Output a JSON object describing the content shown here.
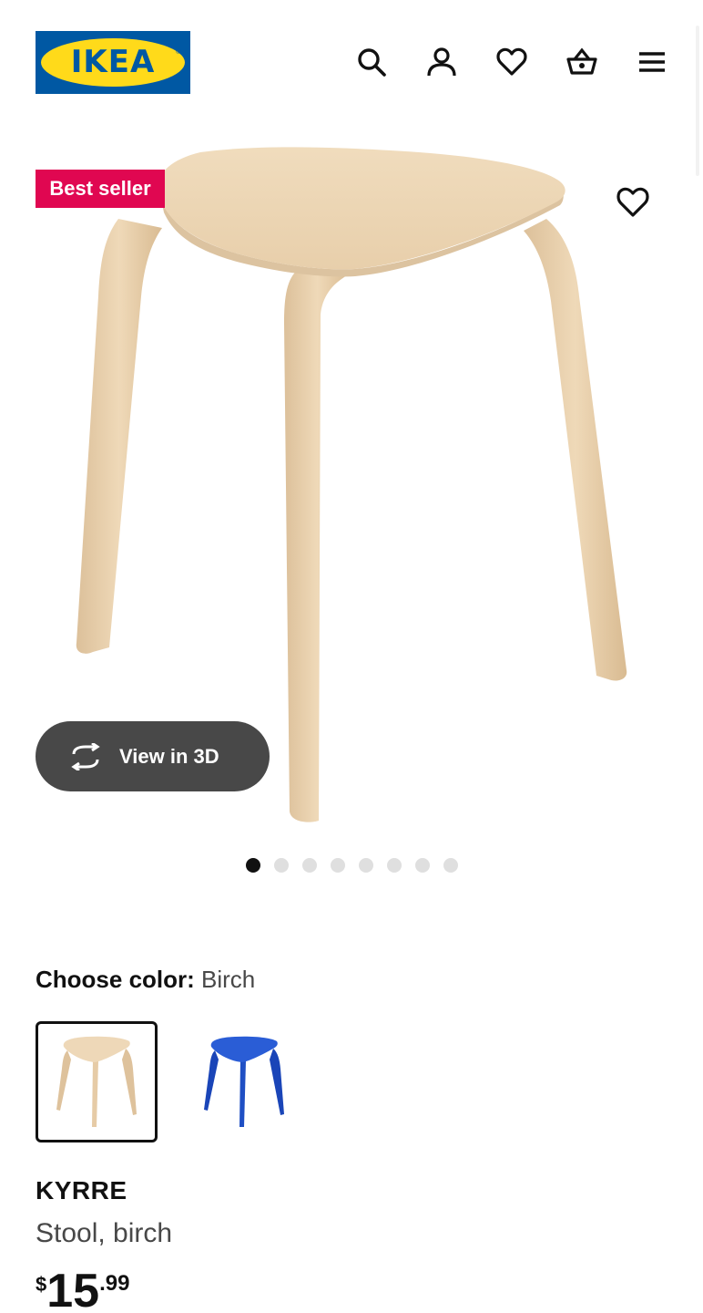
{
  "header": {
    "logo_text": "IKEA",
    "logo_mark": "®",
    "icons": [
      "search-icon",
      "account-icon",
      "heart-icon",
      "basket-icon",
      "menu-icon"
    ]
  },
  "gallery": {
    "badge": "Best seller",
    "view3d_label": "View in 3D",
    "image_count": 8,
    "active_index": 0
  },
  "color": {
    "label": "Choose color:",
    "value": "Birch",
    "options": [
      {
        "name": "birch",
        "color": "#e6cba6",
        "selected": true
      },
      {
        "name": "blue",
        "color": "#1f4fc4",
        "selected": false
      }
    ]
  },
  "product": {
    "name": "KYRRE",
    "description": "Stool, birch",
    "price": {
      "currency": "$",
      "whole": "15",
      "decimal": ".99"
    }
  },
  "colors": {
    "ikea_blue": "#0058a3",
    "ikea_yellow": "#ffda1a",
    "badge_red": "#e00751",
    "button_dark": "#484848"
  }
}
